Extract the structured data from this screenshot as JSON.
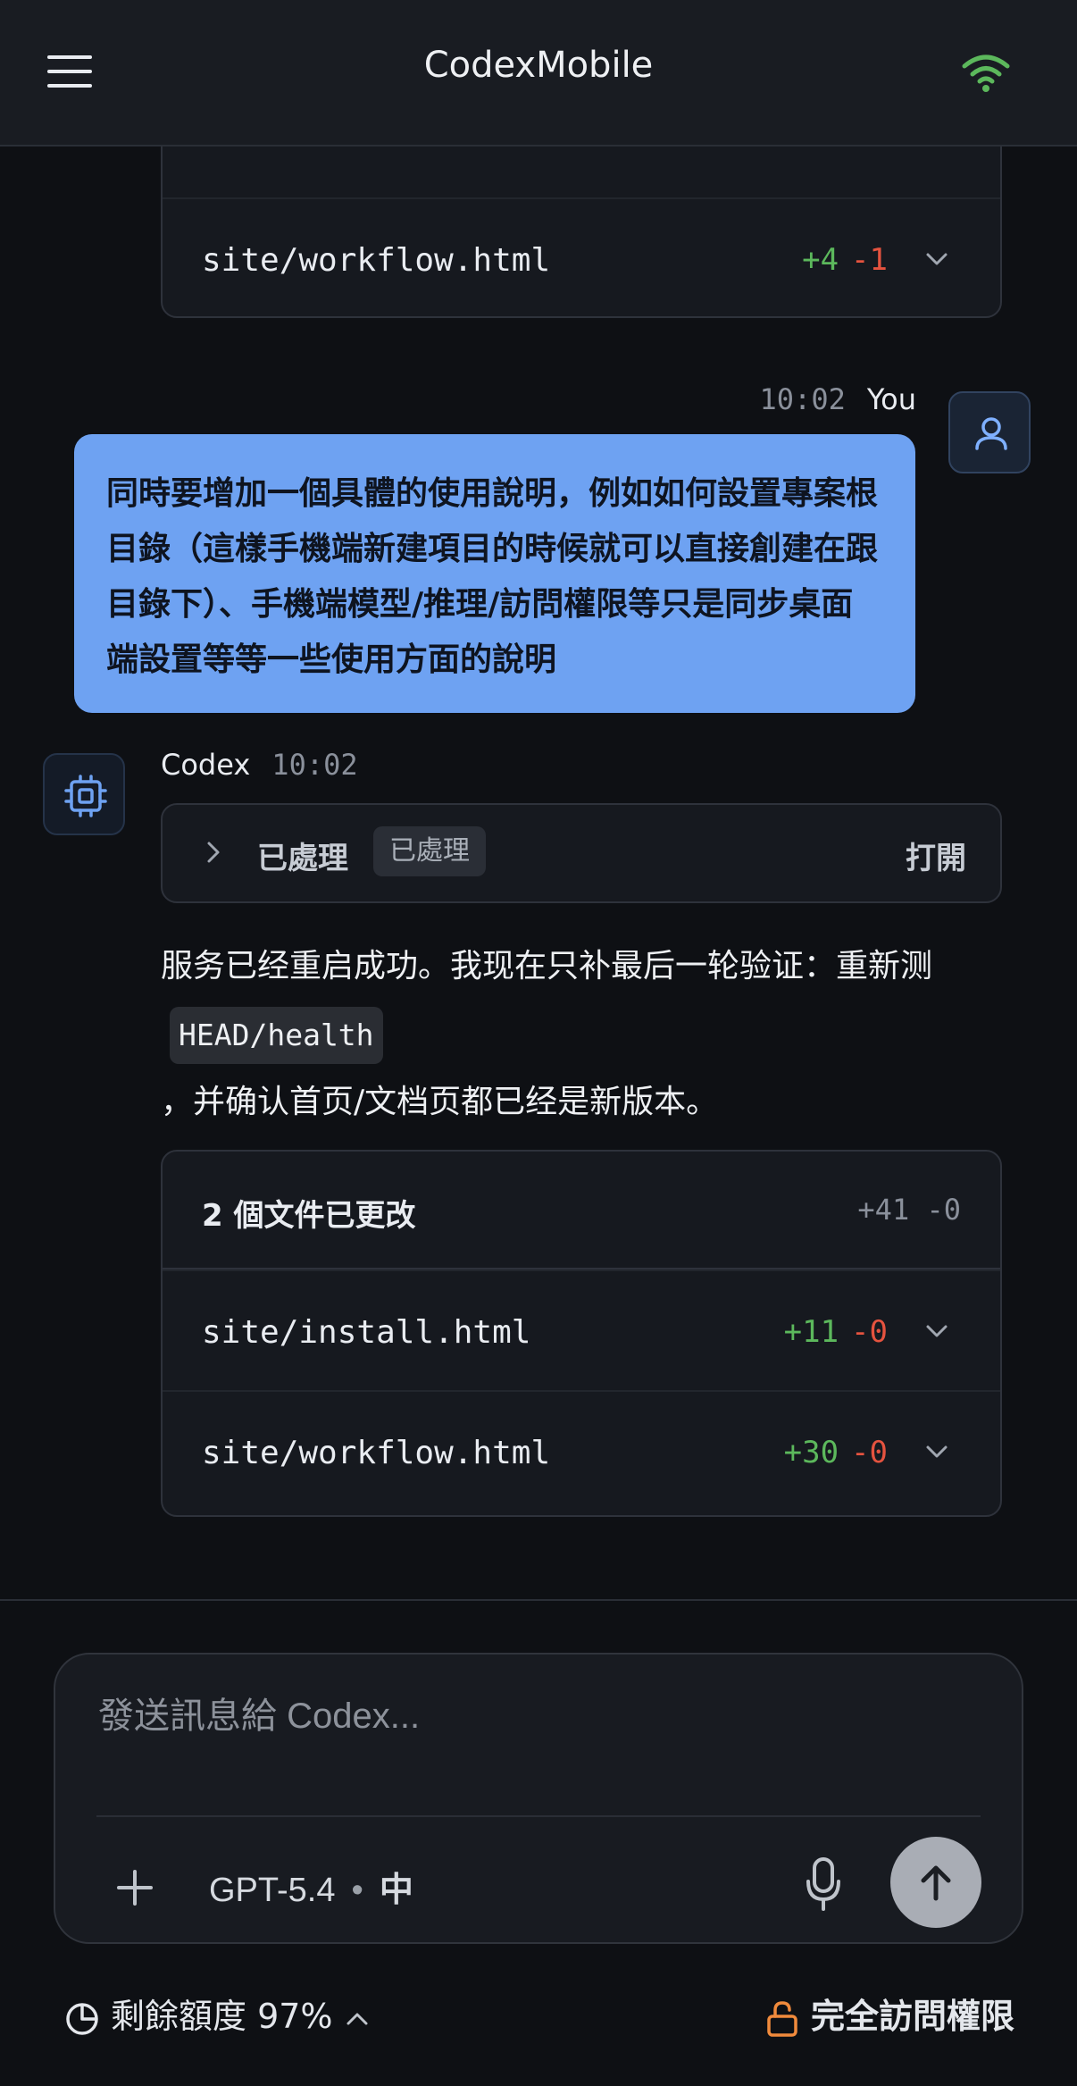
{
  "header": {
    "title": "CodexMobile"
  },
  "previous_changes": {
    "files": [
      {
        "name": "site/workflow.html",
        "added": "+4",
        "removed": "-1"
      }
    ]
  },
  "user_message": {
    "time": "10:02",
    "author": "You",
    "text": "同時要增加一個具體的使用說明，例如如何設置專案根目錄（這樣手機端新建項目的時候就可以直接創建在跟目錄下）、手機端模型/推理/訪問權限等只是同步桌面端設置等等一些使用方面的說明"
  },
  "codex_message": {
    "author": "Codex",
    "time": "10:02",
    "processed_label": "已處理",
    "processed_badge": "已處理",
    "open_label": "打開",
    "reply_part1": "服务已经重启成功。我现在只补最后一轮验证：重新测",
    "reply_code": "HEAD/health",
    "reply_part2": "，并确认首页/文档页都已经是新版本。",
    "changes": {
      "title": "2 個文件已更改",
      "total": "+41 -0",
      "files": [
        {
          "name": "site/install.html",
          "added": "+11",
          "removed": "-0"
        },
        {
          "name": "site/workflow.html",
          "added": "+30",
          "removed": "-0"
        }
      ]
    }
  },
  "composer": {
    "placeholder": "發送訊息給 Codex...",
    "model": "GPT-5.4",
    "reasoning": "中"
  },
  "footer": {
    "quota": "剩餘額度 97%",
    "access": "完全訪問權限"
  },
  "colors": {
    "accent_blue": "#6ea2f2",
    "added_green": "#5cb85c",
    "removed_red": "#e5533f",
    "wifi_green": "#5cb85c",
    "lock_orange": "#f08a3c"
  }
}
